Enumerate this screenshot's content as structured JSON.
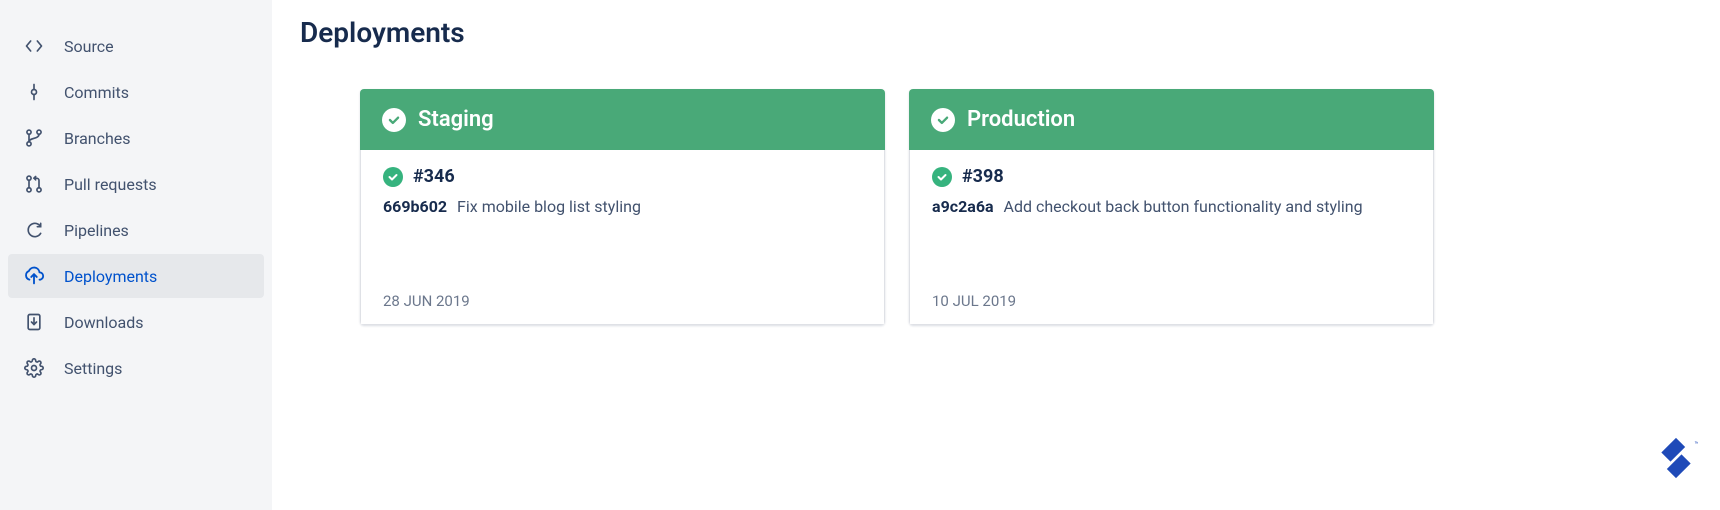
{
  "page_title": "Deployments",
  "sidebar": {
    "items": [
      {
        "id": "source",
        "label": "Source",
        "icon": "source-icon"
      },
      {
        "id": "commits",
        "label": "Commits",
        "icon": "commits-icon"
      },
      {
        "id": "branches",
        "label": "Branches",
        "icon": "branches-icon"
      },
      {
        "id": "pull-requests",
        "label": "Pull requests",
        "icon": "pull-requests-icon"
      },
      {
        "id": "pipelines",
        "label": "Pipelines",
        "icon": "pipelines-icon"
      },
      {
        "id": "deployments",
        "label": "Deployments",
        "icon": "deployments-icon",
        "active": true
      },
      {
        "id": "downloads",
        "label": "Downloads",
        "icon": "downloads-icon"
      },
      {
        "id": "settings",
        "label": "Settings",
        "icon": "settings-icon"
      }
    ]
  },
  "environments": [
    {
      "name": "Staging",
      "status": "success",
      "deployment": {
        "number": "#346",
        "commit_hash": "669b602",
        "commit_message": "Fix mobile blog list styling",
        "date": "28 JUN 2019"
      }
    },
    {
      "name": "Production",
      "status": "success",
      "deployment": {
        "number": "#398",
        "commit_hash": "a9c2a6a",
        "commit_message": "Add checkout back button functionality and styling",
        "date": "10 JUL 2019"
      }
    }
  ],
  "brand": "toptal"
}
